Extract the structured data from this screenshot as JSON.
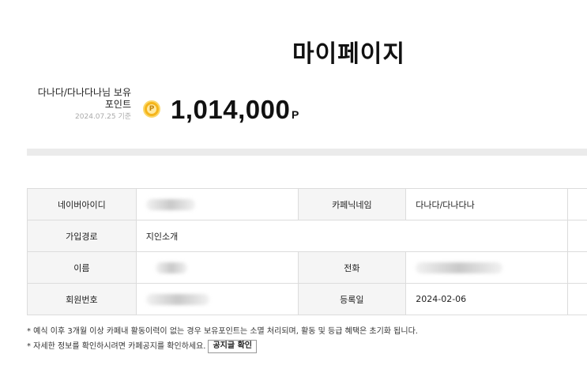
{
  "page": {
    "title": "마이페이지"
  },
  "points": {
    "label": "다나다/다나다나님 보유 포인트",
    "date": "2024.07.25 기준",
    "coin_symbol": "P",
    "amount": "1,014,000",
    "unit": "P"
  },
  "member_info": {
    "naver_id_label": "네이버아이디",
    "nickname_label": "카페닉네임",
    "nickname_value": "다나다/다나다나",
    "join_route_label": "가입경로",
    "join_route_value": "지인소개",
    "name_label": "이름",
    "phone_label": "전화",
    "member_no_label": "회원번호",
    "reg_date_label": "등록일",
    "reg_date_value": "2024-02-06"
  },
  "notes": {
    "line1": "* 예식 이후 3개월 이상 카페내 활동이력이 없는 경우 보유포인트는 소멸 처리되며, 활동 및 등급 혜택은 초기화 됩니다.",
    "line2": "* 자세한 정보를 확인하시려면 카페공지를 확인하세요.",
    "button_label": "공지글 확인"
  },
  "colors": {
    "coin": "#f5b51b",
    "label_bg": "#f5f5f5",
    "divider": "#ebebeb"
  }
}
